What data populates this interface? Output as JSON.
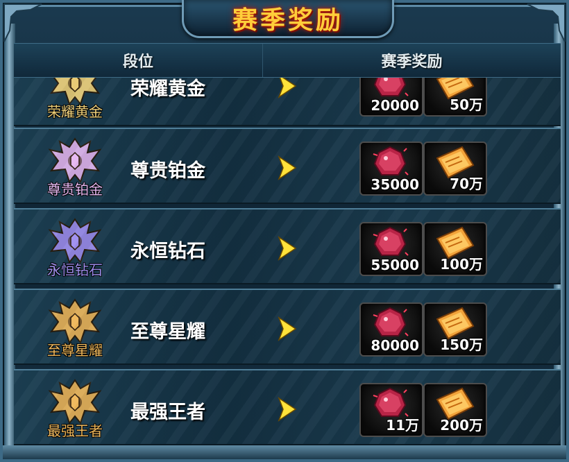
{
  "title": "赛季奖励",
  "headers": {
    "rank": "段位",
    "reward": "赛季奖励"
  },
  "rows": [
    {
      "badge_icon": "gold-rank-emblem-icon",
      "badge_label": "荣耀黄金",
      "rank": "荣耀黄金",
      "badge_color": "#f1d27a",
      "reward_gem": "20000",
      "reward_ticket": "50万"
    },
    {
      "badge_icon": "platinum-rank-emblem-icon",
      "badge_label": "尊贵铂金",
      "rank": "尊贵铂金",
      "badge_color": "#e6b8f3",
      "reward_gem": "35000",
      "reward_ticket": "70万"
    },
    {
      "badge_icon": "diamond-rank-emblem-icon",
      "badge_label": "永恒钻石",
      "rank": "永恒钻石",
      "badge_color": "#9f8ef0",
      "reward_gem": "55000",
      "reward_ticket": "100万"
    },
    {
      "badge_icon": "star-rank-emblem-icon",
      "badge_label": "至尊星耀",
      "rank": "至尊星耀",
      "badge_color": "#f0b85a",
      "reward_gem": "80000",
      "reward_ticket": "150万"
    },
    {
      "badge_icon": "king-rank-emblem-icon",
      "badge_label": "最强王者",
      "rank": "最强王者",
      "badge_color": "#f0b85a",
      "reward_gem": "11万",
      "reward_ticket": "200万"
    }
  ],
  "reward_icons": {
    "gem": "red-gem-icon",
    "ticket": "gold-ticket-icon"
  },
  "colors": {
    "title": "#ffce3a",
    "frame": "#3d6a86",
    "arrow": "#ffe23a"
  }
}
